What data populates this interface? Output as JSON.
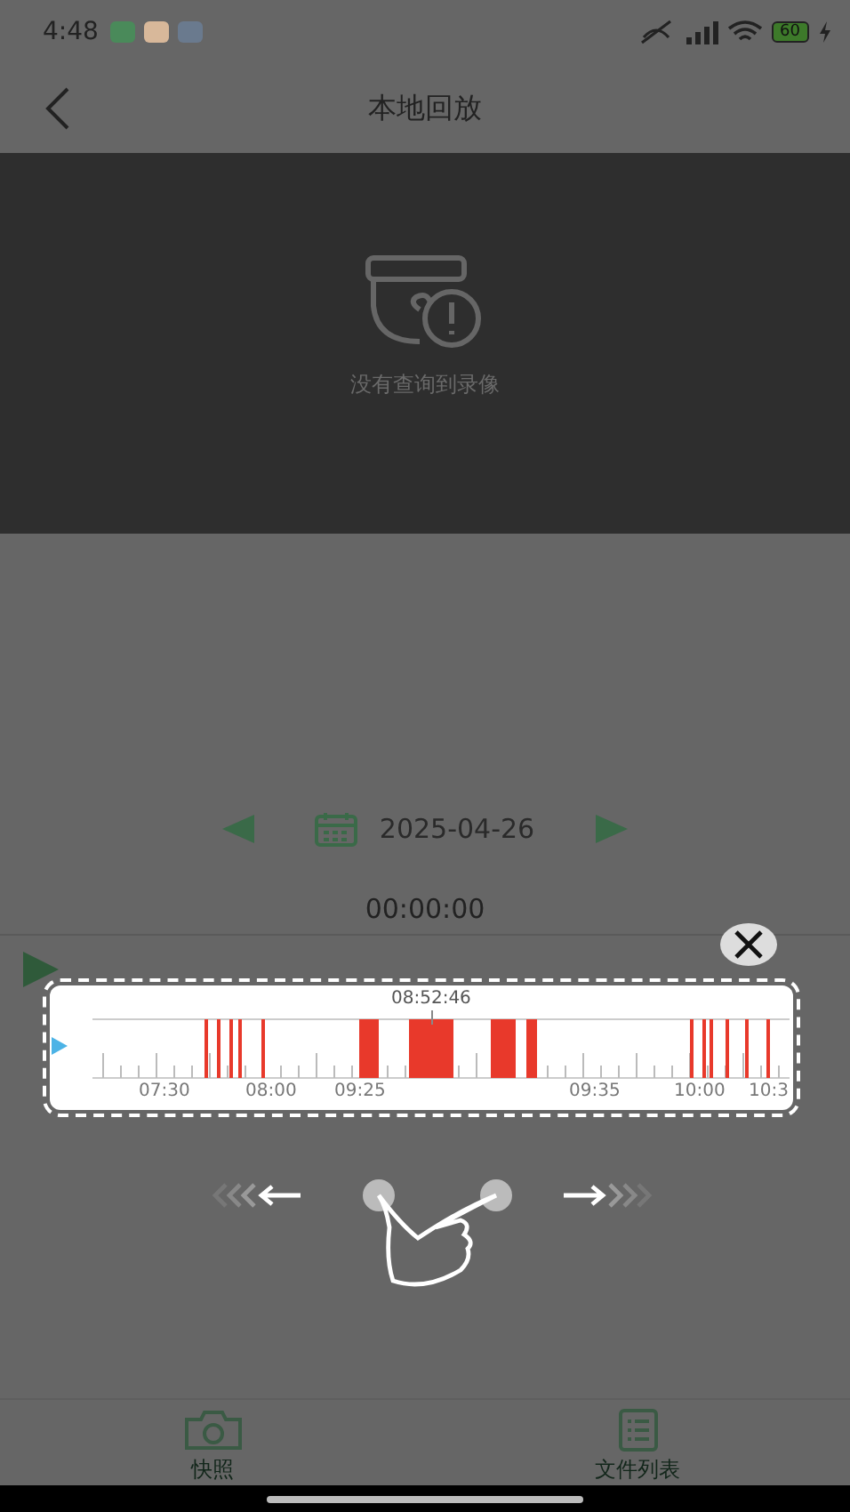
{
  "status_bar": {
    "time": "4:48",
    "battery": "60"
  },
  "header": {
    "title": "本地回放"
  },
  "player": {
    "message": "没有查询到录像"
  },
  "date_bar": {
    "date": "2025-04-26"
  },
  "timeline": {
    "time": "00:00:00"
  },
  "tutorial": {
    "cursor_time": "08:52:46",
    "tick_labels": [
      "07:30",
      "08:00",
      "09:25",
      "09:35",
      "10:00",
      "10:3"
    ]
  },
  "bottom_nav": [
    {
      "label": "快照",
      "kind": "camera"
    },
    {
      "label": "文件列表",
      "kind": "list"
    }
  ]
}
